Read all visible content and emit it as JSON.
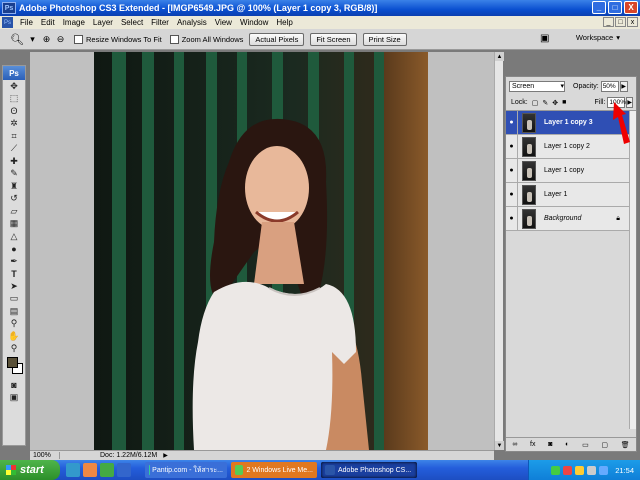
{
  "window": {
    "app_badge": "Ps",
    "title": "Adobe Photoshop CS3 Extended - [IMGP6549.JPG @ 100% (Layer 1 copy 3, RGB/8)]",
    "controls": [
      "_",
      "□",
      "X"
    ],
    "doc_controls": [
      "_",
      "□",
      "x"
    ]
  },
  "menu": [
    "File",
    "Edit",
    "Image",
    "Layer",
    "Select",
    "Filter",
    "Analysis",
    "View",
    "Window",
    "Help"
  ],
  "options_bar": {
    "tool_icon": "zoom-icon",
    "resize_windows": "Resize Windows To Fit",
    "zoom_all_windows": "Zoom All Windows",
    "actual_pixels": "Actual Pixels",
    "fit_screen": "Fit Screen",
    "print_size": "Print Size",
    "workspace": "Workspace"
  },
  "toolbox": {
    "badge": "Ps",
    "tools": [
      "move",
      "marquee",
      "lasso",
      "magic-wand",
      "crop",
      "slice",
      "healing",
      "brush",
      "stamp",
      "history-brush",
      "eraser",
      "gradient",
      "blur",
      "dodge",
      "pen",
      "type",
      "path-select",
      "shape",
      "notes",
      "eyedropper",
      "hand",
      "zoom"
    ],
    "foreground_color": "#5a5138",
    "background_color": "#ffffff"
  },
  "status": {
    "zoom": "100%",
    "doc": "Doc: 1.22M/6.12M"
  },
  "layers_panel": {
    "blend_mode": "Screen",
    "opacity_label": "Opacity:",
    "opacity_value": "50%",
    "lock_label": "Lock:",
    "fill_label": "Fill:",
    "fill_value": "100%",
    "layers": [
      {
        "name": "Layer 1 copy 3",
        "active": true
      },
      {
        "name": "Layer 1 copy 2",
        "active": false
      },
      {
        "name": "Layer 1 copy",
        "active": false
      },
      {
        "name": "Layer 1",
        "active": false
      },
      {
        "name": "Background",
        "active": false,
        "locked": true
      }
    ],
    "accent": "#2f4fb4"
  },
  "taskbar": {
    "start": "start",
    "tasks": [
      {
        "label": "Pantip.com - ให้สาระ...",
        "color": "#3a6fd8",
        "active": false
      },
      {
        "label": "2 Windows Live Me...",
        "color": "#e07820",
        "active": false
      },
      {
        "label": "Adobe Photoshop CS...",
        "color": "#1a3f9f",
        "active": true
      }
    ],
    "clock": "21:54"
  }
}
